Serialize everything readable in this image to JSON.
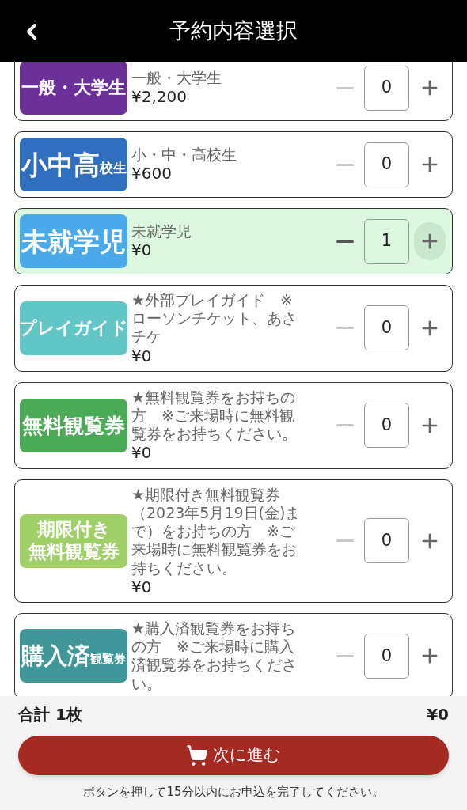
{
  "header": {
    "title": "予約内容選択"
  },
  "tickets": [
    {
      "badge": {
        "text": "一般・大学生",
        "color": "#6b3199"
      },
      "description": "一般・大学生",
      "price": "¥2,200",
      "selected": false,
      "quantity": "0",
      "minus_disabled": true,
      "plus_focused": false
    },
    {
      "badge": {
        "text": "小中高",
        "suffix": "校生",
        "color": "#2f6fbe"
      },
      "description": "小・中・高校生",
      "price": "¥600",
      "selected": false,
      "quantity": "0",
      "minus_disabled": true,
      "plus_focused": false
    },
    {
      "badge": {
        "text": "未就学児",
        "color": "#4aa9e8"
      },
      "description": "未就学児",
      "price": "¥0",
      "selected": true,
      "quantity": "1",
      "minus_disabled": false,
      "plus_focused": true
    },
    {
      "badge": {
        "text": "プレイガイド",
        "color": "#63c6c6"
      },
      "description": "★外部プレイガイド　※ローソンチケット、あさチケ",
      "price": "¥0",
      "selected": false,
      "quantity": "0",
      "minus_disabled": true,
      "plus_focused": false
    },
    {
      "badge": {
        "text": "無料観覧券",
        "color": "#4aaa55"
      },
      "description": "★無料観覧券をお持ちの方　※ご来場時に無料観覧券をお持ちください。",
      "price": "¥0",
      "selected": false,
      "quantity": "0",
      "minus_disabled": true,
      "plus_focused": false
    },
    {
      "badge": {
        "lines": [
          "期限付き",
          "無料観覧券"
        ],
        "color": "#9fd068"
      },
      "description": "★期限付き無料観覧券（2023年5月19日(金)まで）をお持ちの方　※ご来場時に無料観覧券をお持ちください。",
      "price": "¥0",
      "selected": false,
      "quantity": "0",
      "minus_disabled": true,
      "plus_focused": false
    },
    {
      "badge": {
        "text": "購入済",
        "suffix": "観覧券",
        "color": "#40979a"
      },
      "description": "★購入済観覧券をお持ちの方　※ご来場時に購入済観覧券をお持ちください。",
      "selected": false,
      "quantity": "0",
      "minus_disabled": true,
      "plus_focused": false
    }
  ],
  "footer": {
    "total_label": "合計 1枚",
    "total_price": "¥0",
    "next_button": "次に進む",
    "note": "ボタンを押して15分以内にお申込を完了してください。"
  }
}
